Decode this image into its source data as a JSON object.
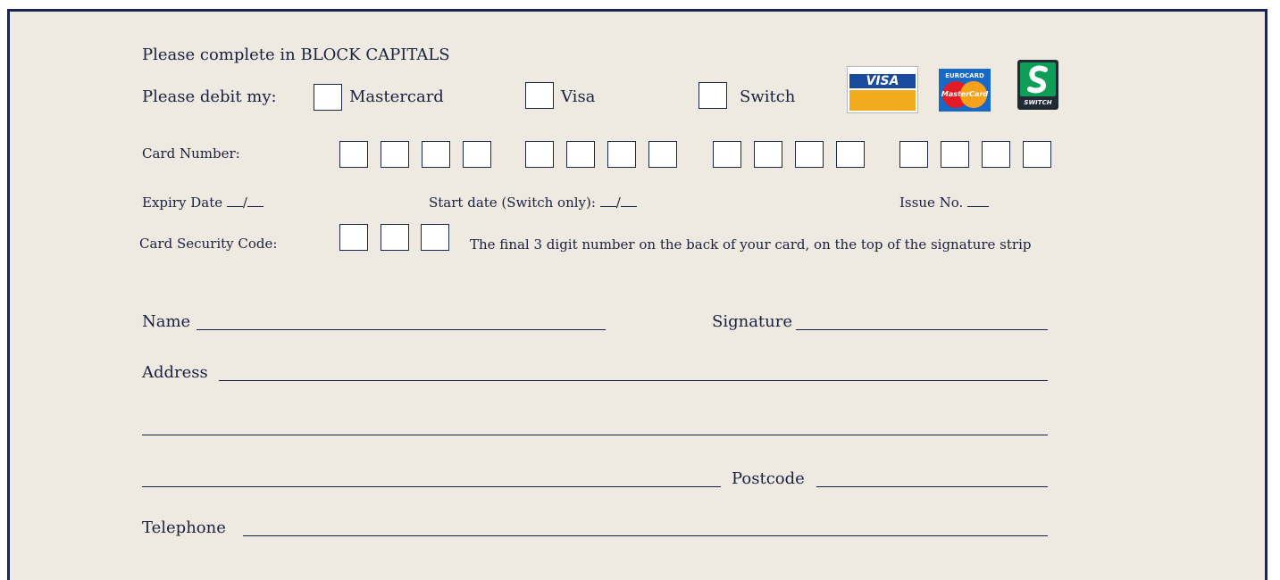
{
  "form": {
    "instructions": "Please complete in BLOCK CAPITALS",
    "debit_label": "Please debit my:",
    "card_options": [
      {
        "label": "Mastercard"
      },
      {
        "label": "Visa"
      },
      {
        "label": "Switch"
      }
    ],
    "logos": {
      "visa_text": "VISA",
      "eurocard_text": "EUROCARD",
      "mastercard_text": "MasterCard",
      "switch_text": "SWITCH"
    },
    "card_number_label": "Card Number:",
    "card_number_groups": 4,
    "card_number_digits_per_group": 4,
    "expiry_label": "Expiry Date",
    "start_date_label": "Start date (Switch only):",
    "issue_label": "Issue No.",
    "date_separator": "/",
    "security_code_label": "Card Security Code:",
    "security_code_digits": 3,
    "security_code_hint": "The final 3 digit number on the back of your card, on the top of the signature strip",
    "name_label": "Name",
    "signature_label": "Signature",
    "address_label": "Address",
    "postcode_label": "Postcode",
    "telephone_label": "Telephone"
  },
  "colors": {
    "border": "#1b2550",
    "background": "#eeeae2",
    "visa_blue": "#1a4a9c",
    "visa_gold": "#f2ab1c",
    "mastercard_red": "#e21b24",
    "mastercard_yellow": "#f7a21b",
    "switch_green": "#0f9e57"
  }
}
